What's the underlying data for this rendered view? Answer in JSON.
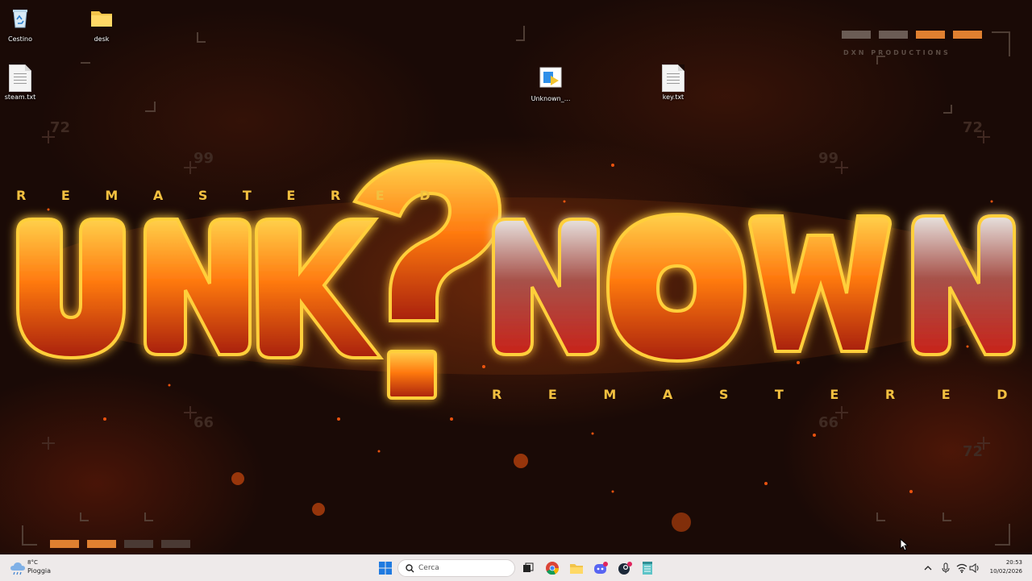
{
  "wallpaper": {
    "title_left": "UNK",
    "title_mark": "?",
    "title_right": "NOWN",
    "top_word": "R E M A S T E R E D",
    "bottom_word": "R E M A S T E R E D",
    "brand": "DXN PRODUCTIONS",
    "deco_numbers": [
      "72",
      "99",
      "66",
      "72",
      "99",
      "66",
      "72"
    ],
    "colors": {
      "lava": "#ff7a10",
      "gold": "#f6c23a",
      "ember": "#c8230c"
    }
  },
  "desktop_icons": [
    {
      "label": "Cestino",
      "icon": "recycle-bin-icon"
    },
    {
      "label": "desk",
      "icon": "folder-icon"
    },
    {
      "label": "steam.txt",
      "icon": "text-file-icon"
    },
    {
      "label": "Unknown_...",
      "icon": "installer-icon"
    },
    {
      "label": "key.txt",
      "icon": "text-file-icon"
    }
  ],
  "taskbar": {
    "weather": {
      "temp": "8°C",
      "condition": "Pioggia",
      "icon": "rain-cloud-icon"
    },
    "search_placeholder": "Cerca",
    "pinned": [
      "start-icon",
      "task-view-icon",
      "chrome-icon",
      "file-explorer-icon",
      "discord-icon",
      "steam-icon",
      "notepad-icon"
    ],
    "tray": {
      "time": "20:53",
      "date": "10/02/2026",
      "icons": [
        "chevron-up-icon",
        "microphone-icon",
        "wifi-icon",
        "speaker-icon"
      ]
    }
  }
}
